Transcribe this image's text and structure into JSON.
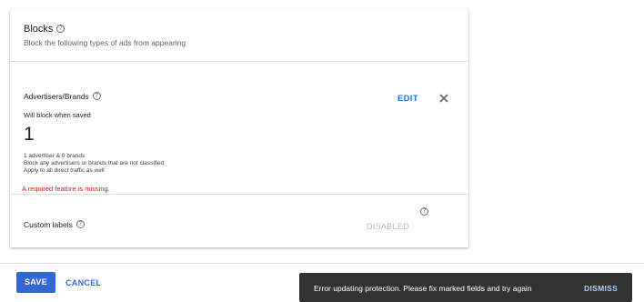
{
  "blocks": {
    "title": "Blocks",
    "subtitle": "Block the following types of ads from appearing",
    "help_icon": "help-circle-icon"
  },
  "advertisers": {
    "label": "Advertisers/Brands",
    "edit_label": "EDIT",
    "close_icon": "close-icon",
    "caption": "Will block when saved",
    "count": "1",
    "details": [
      "1 advertiser & 0 brands",
      "Block any advertisers or brands that are not classified",
      "Apply to all direct traffic as well"
    ],
    "error": "A required feature is missing."
  },
  "custom_labels": {
    "label": "Custom labels",
    "status": "DISABLED"
  },
  "footer": {
    "save_label": "SAVE",
    "cancel_label": "CANCEL"
  },
  "snackbar": {
    "message": "Error updating protection. Please fix marked fields and try again",
    "dismiss_label": "DISMISS"
  },
  "colors": {
    "accent": "#1a73e8",
    "primary_button": "#3367d6",
    "error": "#c5221f",
    "snackbar_bg": "#323232",
    "snackbar_action": "#aecbfa"
  }
}
